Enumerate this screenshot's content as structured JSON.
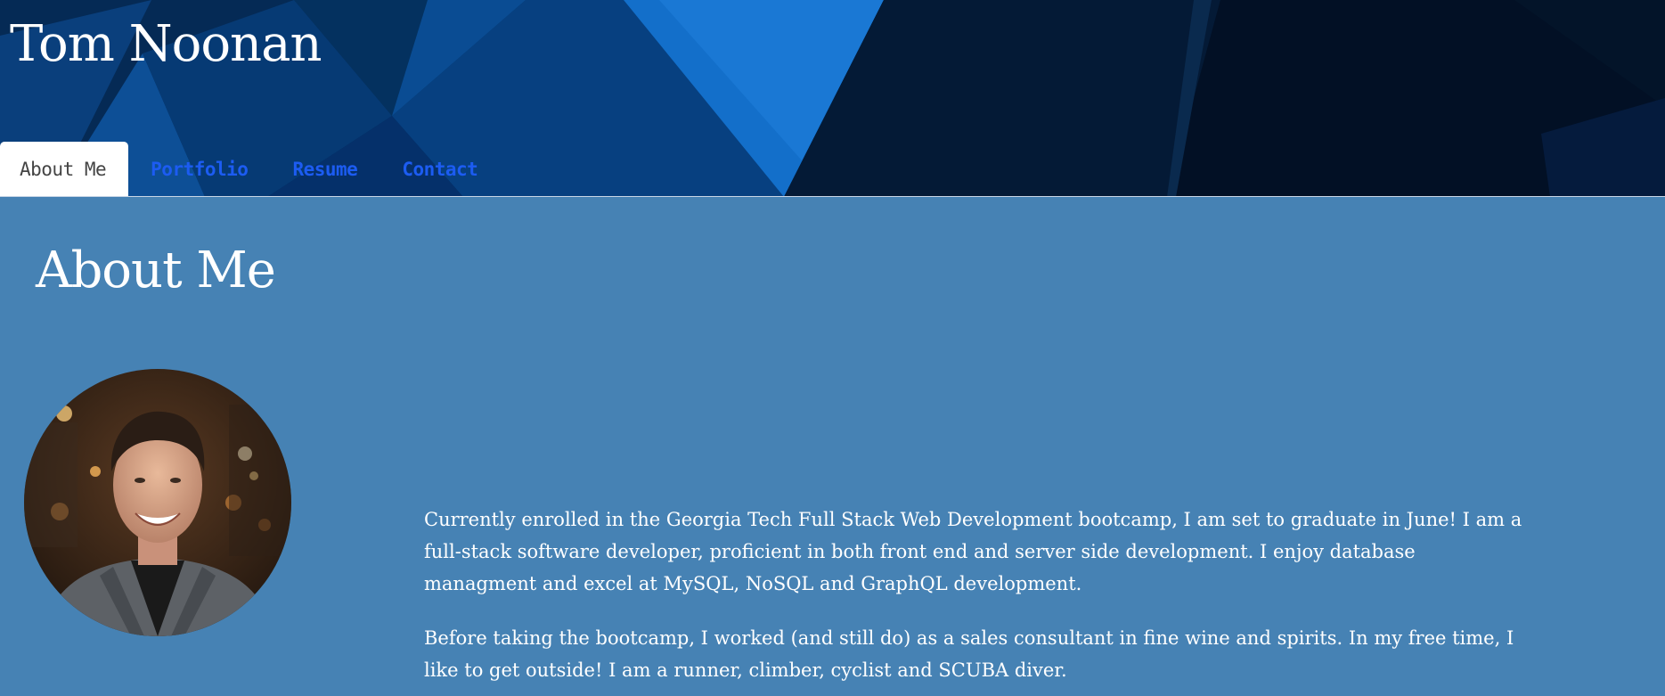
{
  "header": {
    "site_title": "Tom Noonan"
  },
  "nav": {
    "tabs": [
      {
        "label": "About Me",
        "active": true
      },
      {
        "label": "Portfolio",
        "active": false
      },
      {
        "label": "Resume",
        "active": false
      },
      {
        "label": "Contact",
        "active": false
      }
    ]
  },
  "main": {
    "section_title": "About Me",
    "bio_paragraphs": [
      "Currently enrolled in the Georgia Tech Full Stack Web Development bootcamp, I am set to graduate in June! I am a full-stack software developer, proficient in both front end and server side development. I enjoy database managment and excel at MySQL, NoSQL and GraphQL development.",
      "Before taking the bootcamp, I worked (and still do) as a sales consultant in fine wine and spirits. In my free time, I like to get outside! I am a runner, climber, cyclist and SCUBA diver."
    ]
  },
  "colors": {
    "page_background": "#4682b4",
    "header_dark": "#03152e",
    "header_accent": "#136fca",
    "nav_link": "#1c5cf2",
    "nav_active_bg": "#ffffff",
    "nav_active_text": "#444444"
  }
}
